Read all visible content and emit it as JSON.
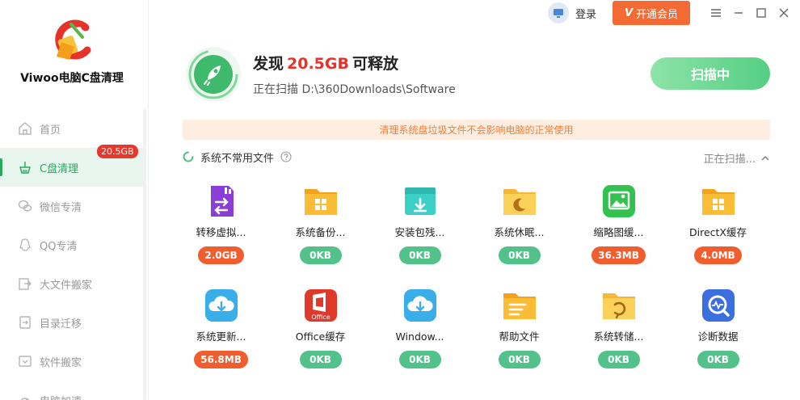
{
  "app": {
    "name": "Viwoo电脑C盘清理"
  },
  "topbar": {
    "login_label": "登录",
    "vip_label": "开通会员",
    "vip_mark": "V"
  },
  "sidebar": {
    "items": [
      {
        "label": "首页",
        "icon": "home-icon"
      },
      {
        "label": "C盘清理",
        "icon": "broom-icon",
        "badge": "20.5GB",
        "active": true
      },
      {
        "label": "微信专清",
        "icon": "wechat-icon"
      },
      {
        "label": "QQ专清",
        "icon": "qq-icon"
      },
      {
        "label": "大文件搬家",
        "icon": "move-icon"
      },
      {
        "label": "目录迁移",
        "icon": "migrate-icon"
      },
      {
        "label": "软件搬家",
        "icon": "software-icon"
      },
      {
        "label": "电脑加速",
        "icon": "speed-icon"
      }
    ]
  },
  "header": {
    "title_prefix": "发现",
    "title_size": "20.5GB",
    "title_suffix": "可释放",
    "scan_path": "正在扫描 D:\\360Downloads\\Software",
    "scan_button": "扫描中"
  },
  "notice": "清理系统盘垃圾文件不会影响电脑的正常使用",
  "section": {
    "title": "系统不常用文件",
    "status": "正在扫描..."
  },
  "tiles": [
    {
      "label": "转移虚拟...",
      "size": "2.0GB",
      "level": "red",
      "icon": "virtual-memory-icon"
    },
    {
      "label": "系统备份...",
      "size": "0KB",
      "level": "green",
      "icon": "windows-folder-icon"
    },
    {
      "label": "安装包残...",
      "size": "0KB",
      "level": "green",
      "icon": "installer-icon"
    },
    {
      "label": "系统休眠...",
      "size": "0KB",
      "level": "green",
      "icon": "sleep-folder-icon"
    },
    {
      "label": "缩略图缓...",
      "size": "36.3MB",
      "level": "red",
      "icon": "thumbnail-icon"
    },
    {
      "label": "DirectX缓存",
      "size": "4.0MB",
      "level": "red",
      "icon": "directx-folder-icon"
    },
    {
      "label": "系统更新...",
      "size": "56.8MB",
      "level": "red",
      "icon": "cloud-download-icon"
    },
    {
      "label": "Office缓存",
      "size": "0KB",
      "level": "green",
      "icon": "office-icon"
    },
    {
      "label": "Window...",
      "size": "0KB",
      "level": "green",
      "icon": "cloud-download-icon"
    },
    {
      "label": "帮助文件",
      "size": "0KB",
      "level": "green",
      "icon": "help-folder-icon"
    },
    {
      "label": "系统转储...",
      "size": "0KB",
      "level": "green",
      "icon": "dump-folder-icon"
    },
    {
      "label": "诊断数据",
      "size": "0KB",
      "level": "green",
      "icon": "diagnostic-icon"
    }
  ],
  "colors": {
    "accent": "#2aa85e",
    "alert": "#e5332a",
    "vip": "#f46a34",
    "notice_bg": "#fdeee1",
    "notice_text": "#ee7f3b"
  }
}
